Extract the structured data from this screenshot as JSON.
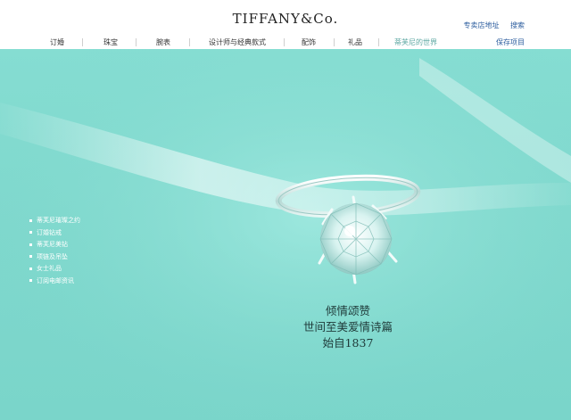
{
  "header": {
    "logo": "TIFFANY&Co.",
    "util_links": [
      "专卖店地址",
      "搜索"
    ],
    "nav": [
      "订婚",
      "珠宝",
      "腕表",
      "设计师与经典款式",
      "配饰",
      "礼品",
      "蒂芙尼的世界"
    ],
    "active_nav_index": 6,
    "save_items": "保存项目"
  },
  "side_menu": {
    "items": [
      "蒂芙尼璀璨之约",
      "订婚钻戒",
      "蒂芙尼美钻",
      "项链及吊坠",
      "女士礼品",
      "订阅电邮资讯"
    ]
  },
  "tagline": {
    "line1": "倾情颂赞",
    "line2": "世间至美爱情诗篇",
    "line3": "始自1837"
  },
  "colors": {
    "tiffany_blue": "#81dacf",
    "link_blue": "#2b5c9e",
    "active_nav": "#5aa6a0"
  }
}
